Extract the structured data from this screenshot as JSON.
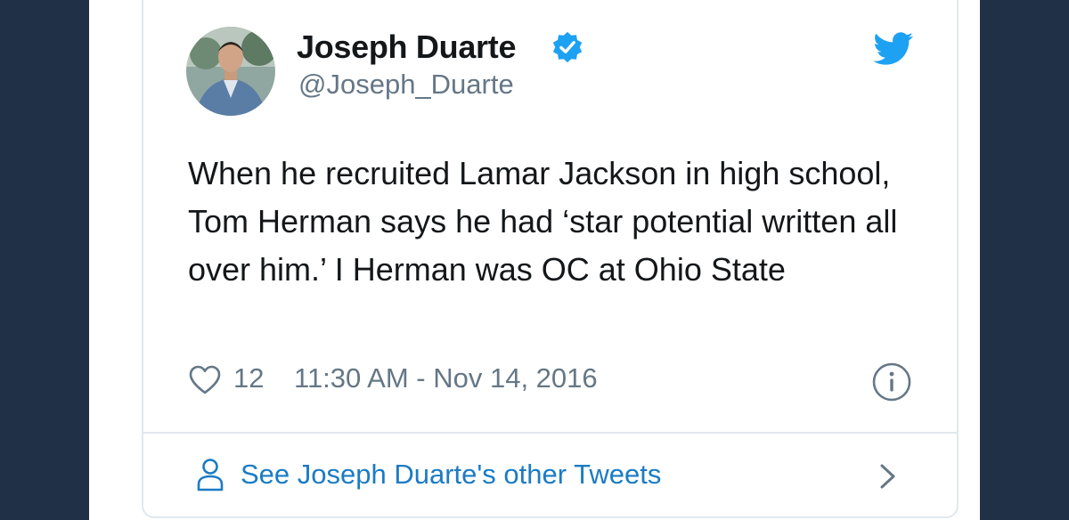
{
  "tweet": {
    "display_name": "Joseph Duarte",
    "handle": "@Joseph_Duarte",
    "verified": true,
    "text": "When he recruited Lamar Jackson in high school, Tom Herman says he had ‘star potential written all over him.’ I Herman was OC at Ohio State",
    "like_count": "12",
    "timestamp": "11:30 AM - Nov 14, 2016"
  },
  "footer": {
    "see_other_label": "See Joseph Duarte's other Tweets"
  },
  "icons": {
    "brand": "twitter-bird-icon",
    "verified": "verified-badge-icon",
    "like": "heart-icon",
    "info": "info-icon",
    "profile": "person-icon",
    "next": "chevron-right-icon"
  },
  "colors": {
    "page_background": "#1f3047",
    "twitter_blue": "#1da1f2",
    "link_blue": "#1b7bc4",
    "text_primary": "#14171a",
    "text_secondary": "#657786",
    "border": "#e1e8ed"
  }
}
